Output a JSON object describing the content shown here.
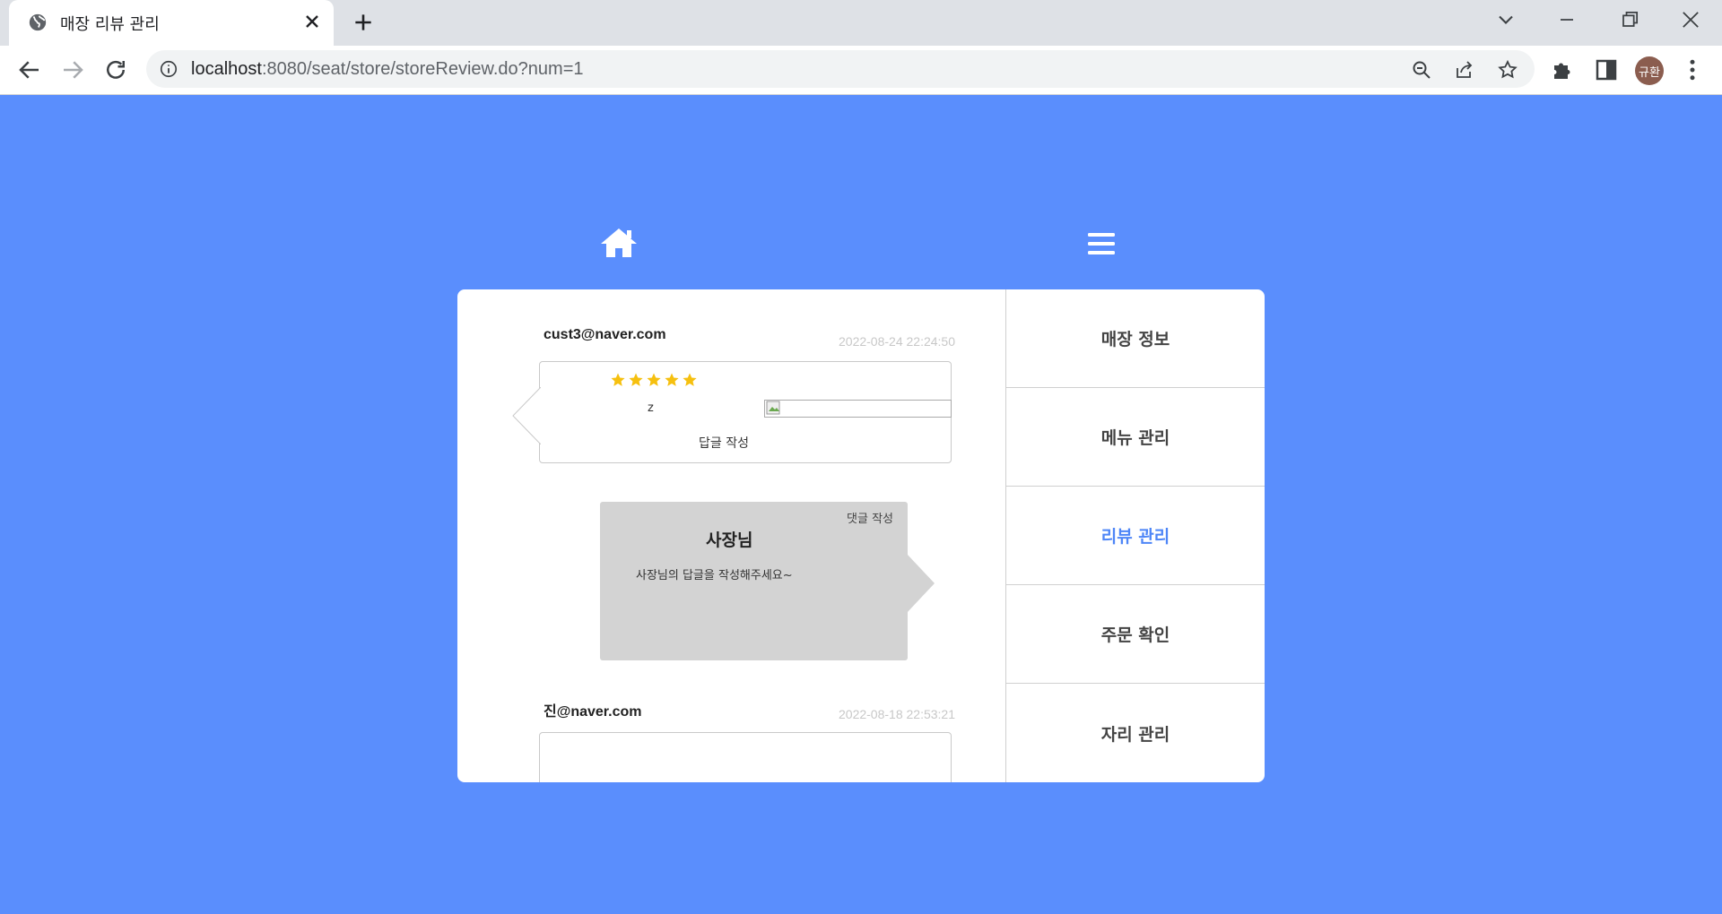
{
  "browser": {
    "tab_title": "매장 리뷰 관리",
    "url_host": "localhost",
    "url_rest": ":8080/seat/store/storeReview.do?num=1",
    "profile_label": "규환"
  },
  "reviews": [
    {
      "author": "cust3@naver.com",
      "date": "2022-08-24 22:24:50",
      "rating": 5,
      "text": "z",
      "reply_label": "답글 작성"
    },
    {
      "author": "진@naver.com",
      "date": "2022-08-18 22:53:21"
    }
  ],
  "owner_reply": {
    "write_label": "댓글 작성",
    "title": "사장님",
    "placeholder_text": "사장님의 답글을 작성해주세요~"
  },
  "side_menu": {
    "items": [
      {
        "label": "매장 정보"
      },
      {
        "label": "메뉴 관리"
      },
      {
        "label": "리뷰 관리"
      },
      {
        "label": "주문 확인"
      },
      {
        "label": "자리 관리"
      }
    ],
    "active_index": 2
  },
  "colors": {
    "page_background": "#5a8efd",
    "active_menu": "#4e86f7",
    "star": "#f6c00f",
    "owner_box": "#d3d3d3"
  }
}
